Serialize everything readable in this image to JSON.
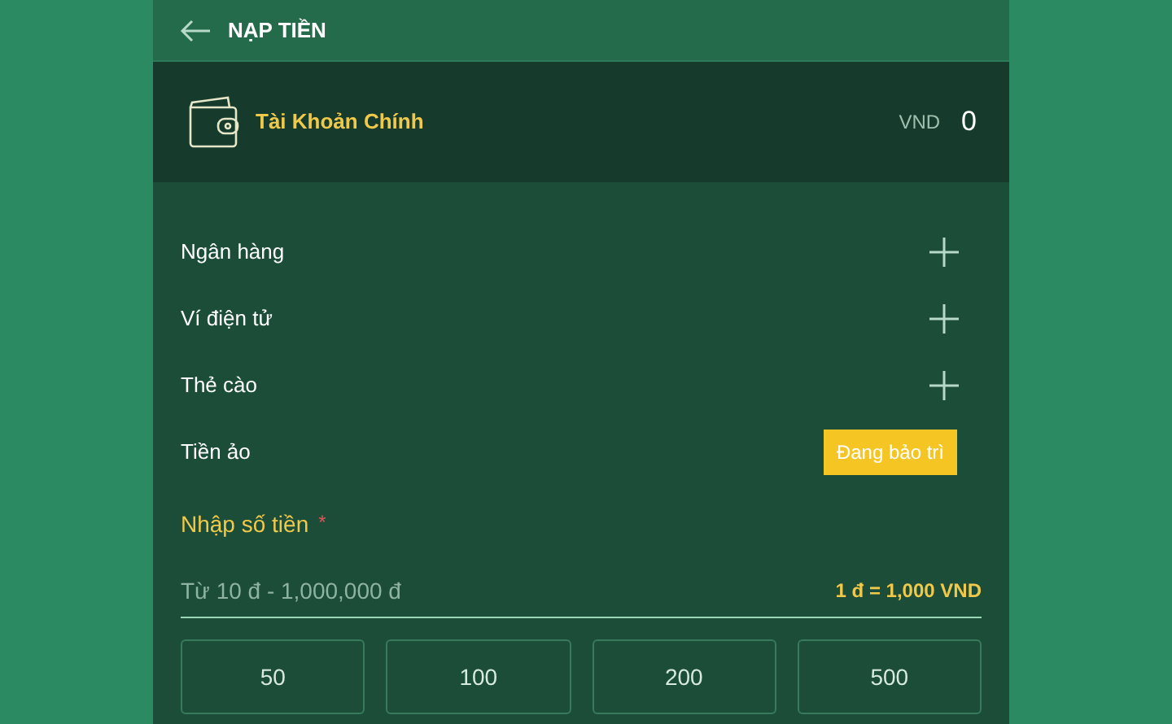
{
  "header": {
    "title": "NẠP TIỀN"
  },
  "account": {
    "name": "Tài Khoản Chính",
    "currency": "VND",
    "balance": "0"
  },
  "methods": [
    {
      "label": "Ngân hàng",
      "kind": "add"
    },
    {
      "label": "Ví điện tử",
      "kind": "add"
    },
    {
      "label": "Thẻ cào",
      "kind": "add"
    },
    {
      "label": "Tiền ảo",
      "kind": "badge",
      "badge": "Đang bảo trì"
    }
  ],
  "amount": {
    "label": "Nhập số tiền",
    "required_mark": "*",
    "placeholder": "Từ 10 đ - 1,000,000 đ",
    "rate": "1 đ = 1,000 VND"
  },
  "presets": [
    "50",
    "100",
    "200",
    "500"
  ]
}
